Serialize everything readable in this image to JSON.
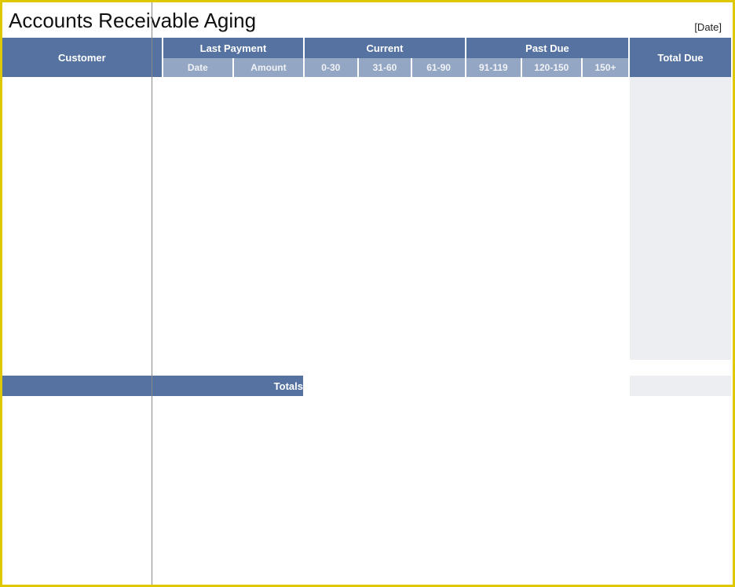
{
  "header": {
    "title": "Accounts Receivable Aging",
    "date_placeholder": "[Date]"
  },
  "table": {
    "group_headers": {
      "customer": "Customer",
      "last_payment": "Last Payment",
      "current": "Current",
      "past_due": "Past Due",
      "total_due": "Total Due"
    },
    "sub_headers": {
      "date": "Date",
      "amount": "Amount",
      "b0_30": "0-30",
      "b31_60": "31-60",
      "b61_90": "61-90",
      "b91_119": "91-119",
      "b120_150": "120-150",
      "b150p": "150+"
    },
    "rows": [
      {
        "customer": "",
        "date": "",
        "amount": "",
        "b0_30": "",
        "b31_60": "",
        "b61_90": "",
        "b91_119": "",
        "b120_150": "",
        "b150p": "",
        "total": ""
      },
      {
        "customer": "",
        "date": "",
        "amount": "",
        "b0_30": "",
        "b31_60": "",
        "b61_90": "",
        "b91_119": "",
        "b120_150": "",
        "b150p": "",
        "total": ""
      },
      {
        "customer": "",
        "date": "",
        "amount": "",
        "b0_30": "",
        "b31_60": "",
        "b61_90": "",
        "b91_119": "",
        "b120_150": "",
        "b150p": "",
        "total": ""
      },
      {
        "customer": "",
        "date": "",
        "amount": "",
        "b0_30": "",
        "b31_60": "",
        "b61_90": "",
        "b91_119": "",
        "b120_150": "",
        "b150p": "",
        "total": ""
      },
      {
        "customer": "",
        "date": "",
        "amount": "",
        "b0_30": "",
        "b31_60": "",
        "b61_90": "",
        "b91_119": "",
        "b120_150": "",
        "b150p": "",
        "total": ""
      },
      {
        "customer": "",
        "date": "",
        "amount": "",
        "b0_30": "",
        "b31_60": "",
        "b61_90": "",
        "b91_119": "",
        "b120_150": "",
        "b150p": "",
        "total": ""
      },
      {
        "customer": "",
        "date": "",
        "amount": "",
        "b0_30": "",
        "b31_60": "",
        "b61_90": "",
        "b91_119": "",
        "b120_150": "",
        "b150p": "",
        "total": ""
      },
      {
        "customer": "",
        "date": "",
        "amount": "",
        "b0_30": "",
        "b31_60": "",
        "b61_90": "",
        "b91_119": "",
        "b120_150": "",
        "b150p": "",
        "total": ""
      },
      {
        "customer": "",
        "date": "",
        "amount": "",
        "b0_30": "",
        "b31_60": "",
        "b61_90": "",
        "b91_119": "",
        "b120_150": "",
        "b150p": "",
        "total": ""
      },
      {
        "customer": "",
        "date": "",
        "amount": "",
        "b0_30": "",
        "b31_60": "",
        "b61_90": "",
        "b91_119": "",
        "b120_150": "",
        "b150p": "",
        "total": ""
      },
      {
        "customer": "",
        "date": "",
        "amount": "",
        "b0_30": "",
        "b31_60": "",
        "b61_90": "",
        "b91_119": "",
        "b120_150": "",
        "b150p": "",
        "total": ""
      },
      {
        "customer": "",
        "date": "",
        "amount": "",
        "b0_30": "",
        "b31_60": "",
        "b61_90": "",
        "b91_119": "",
        "b120_150": "",
        "b150p": "",
        "total": ""
      },
      {
        "customer": "",
        "date": "",
        "amount": "",
        "b0_30": "",
        "b31_60": "",
        "b61_90": "",
        "b91_119": "",
        "b120_150": "",
        "b150p": "",
        "total": ""
      },
      {
        "customer": "",
        "date": "",
        "amount": "",
        "b0_30": "",
        "b31_60": "",
        "b61_90": "",
        "b91_119": "",
        "b120_150": "",
        "b150p": "",
        "total": ""
      },
      {
        "customer": "",
        "date": "",
        "amount": "",
        "b0_30": "",
        "b31_60": "",
        "b61_90": "",
        "b91_119": "",
        "b120_150": "",
        "b150p": "",
        "total": ""
      }
    ],
    "totals_label": "Totals",
    "totals": {
      "b0_30": "",
      "b31_60": "",
      "b61_90": "",
      "b91_119": "",
      "b120_150": "",
      "b150p": "",
      "total": ""
    }
  }
}
